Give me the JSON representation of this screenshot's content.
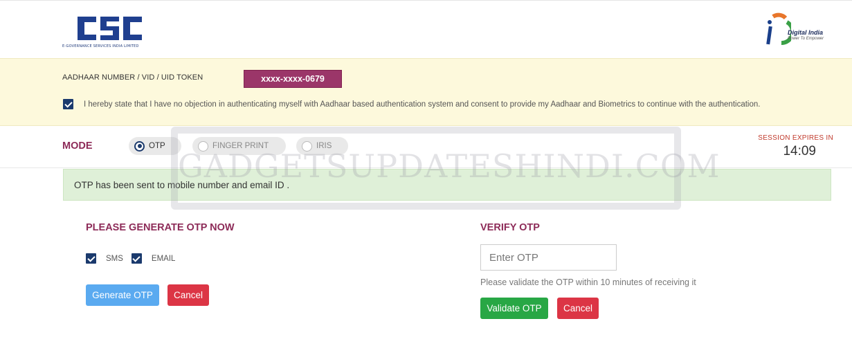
{
  "header": {
    "csc_logo_text": "CSC",
    "csc_logo_subtitle": "e-Governance Services India Limited",
    "digital_india_title": "Digital India",
    "digital_india_tagline": "Power To Empower"
  },
  "aadhaar": {
    "label": "AADHAAR NUMBER / VID / UID TOKEN",
    "token_value": "xxxx-xxxx-0679",
    "consent_checked": true,
    "consent_text": "I hereby state that I have no objection in authenticating myself with Aadhaar based authentication system and consent to provide my Aadhaar and Biometrics to continue with the authentication."
  },
  "mode": {
    "label": "MODE",
    "options": [
      {
        "label": "OTP",
        "selected": true
      },
      {
        "label": "FINGER PRINT",
        "selected": false
      },
      {
        "label": "IRIS",
        "selected": false
      }
    ]
  },
  "session": {
    "label": "SESSION EXPIRES IN",
    "time": "14:09"
  },
  "watermark": "GADGETSUPDATESHINDI.COM",
  "alert": {
    "message": "OTP has been sent to mobile number and email ID ."
  },
  "generate": {
    "title": "PLEASE GENERATE OTP NOW",
    "sms_label": "SMS",
    "email_label": "EMAIL",
    "generate_button": "Generate OTP",
    "cancel_button": "Cancel"
  },
  "verify": {
    "title": "VERIFY OTP",
    "input_placeholder": "Enter OTP",
    "note": "Please validate the OTP within 10 minutes of receiving it",
    "validate_button": "Validate OTP",
    "cancel_button": "Cancel"
  },
  "colors": {
    "brand_maroon": "#8d2b58",
    "token_bg": "#9b3669",
    "checkbox_navy": "#1b3a6d",
    "panel_yellow": "#fdf9dc",
    "alert_green": "#dff0d8",
    "generate_blue": "#5aaaf0",
    "validate_green": "#28a745",
    "cancel_red": "#dc3545"
  }
}
